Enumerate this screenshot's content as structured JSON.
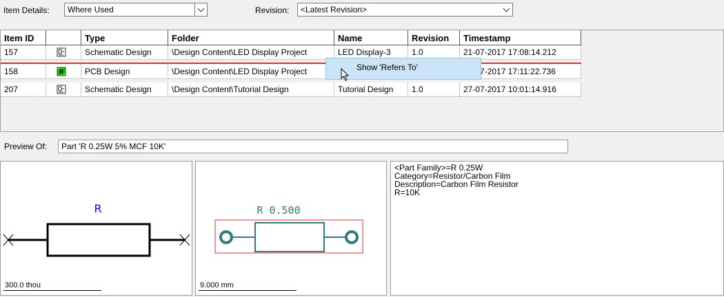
{
  "toolbar": {
    "item_details_label": "Item Details:",
    "item_details_value": "Where Used",
    "revision_label": "Revision:",
    "revision_value": "<Latest Revision>"
  },
  "table": {
    "headers": [
      "Item ID",
      "",
      "Type",
      "Folder",
      "Name",
      "Revision",
      "Timestamp"
    ],
    "rows": [
      {
        "id": "157",
        "icon": "schematic-icon",
        "type": "Schematic Design",
        "folder": "\\Design Content\\LED Display Project",
        "name": "LED Display-3",
        "revision": "1.0",
        "timestamp": "21-07-2017 17:08:14.212"
      },
      {
        "id": "158",
        "icon": "pcb-icon",
        "type": "PCB Design",
        "folder": "\\Design Content\\LED Display Project",
        "name": "",
        "revision": "",
        "timestamp": "27-07-2017 17:11:22.736"
      },
      {
        "id": "207",
        "icon": "schematic-icon",
        "type": "Schematic Design",
        "folder": "\\Design Content\\Tutorial Design",
        "name": "Tutorial Design",
        "revision": "1.0",
        "timestamp": "27-07-2017 10:01:14.916"
      }
    ]
  },
  "context_menu": {
    "item": "Show 'Refers To'"
  },
  "preview": {
    "label": "Preview Of:",
    "value": "Part 'R 0.25W 5% MCF 10K'",
    "symbol": {
      "designator": "R",
      "scale": "300.0 thou"
    },
    "footprint": {
      "label": "R 0.500",
      "scale": "9.000 mm"
    },
    "properties": [
      "<Part Family>=R 0.25W",
      "Category=Resistor/Carbon Film",
      "Description=Carbon Film Resistor",
      "R=10K"
    ]
  },
  "colors": {
    "selection_line": "#e03030",
    "menu_highlight": "#cce4f7",
    "designator_blue": "#0000ff",
    "footprint_teal": "#2f7a7a",
    "footprint_red": "#e03030"
  }
}
